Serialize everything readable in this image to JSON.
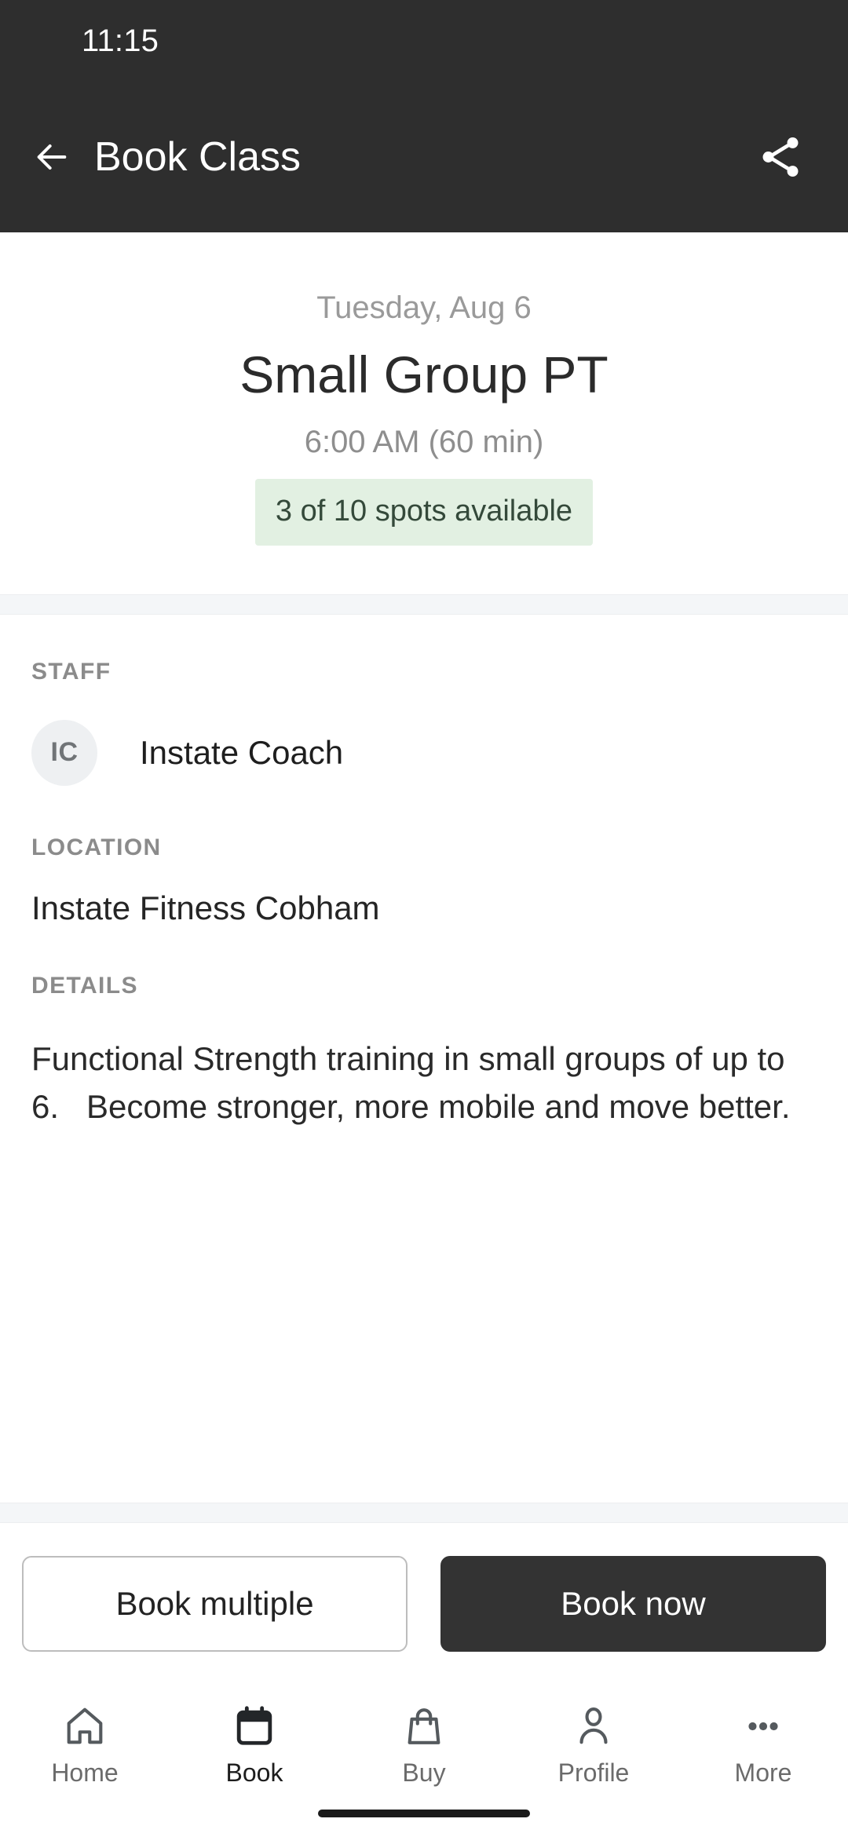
{
  "status_bar": {
    "time": "11:15"
  },
  "app_bar": {
    "title": "Book Class",
    "back_icon": "arrow-left-icon",
    "share_icon": "share-icon"
  },
  "hero": {
    "date": "Tuesday, Aug 6",
    "class_name": "Small Group PT",
    "time_duration": "6:00 AM (60 min)",
    "spots_badge": "3 of 10 spots available",
    "spots_badge_bg": "#e2f0e2",
    "spots_badge_color": "#34493a"
  },
  "sections": {
    "staff_label": "STAFF",
    "staff_initials": "IC",
    "staff_name": "Instate Coach",
    "location_label": "LOCATION",
    "location_value": "Instate Fitness Cobham",
    "details_label": "DETAILS",
    "details_value": "Functional Strength training in small groups of up to 6.   Become stronger, more mobile and move better."
  },
  "actions": {
    "book_multiple": "Book multiple",
    "book_now": "Book now",
    "primary_color": "#333333",
    "secondary_border": "#bdbdbd"
  },
  "bottom_nav": {
    "items": [
      {
        "label": "Home",
        "icon": "home-icon",
        "active": false
      },
      {
        "label": "Book",
        "icon": "calendar-icon",
        "active": true
      },
      {
        "label": "Buy",
        "icon": "bag-icon",
        "active": false
      },
      {
        "label": "Profile",
        "icon": "person-icon",
        "active": false
      },
      {
        "label": "More",
        "icon": "more-dots-icon",
        "active": false
      }
    ]
  },
  "theme": {
    "app_bar_bg": "#2e2e2e",
    "page_bg": "#ffffff",
    "band_bg": "#f4f6f8"
  }
}
